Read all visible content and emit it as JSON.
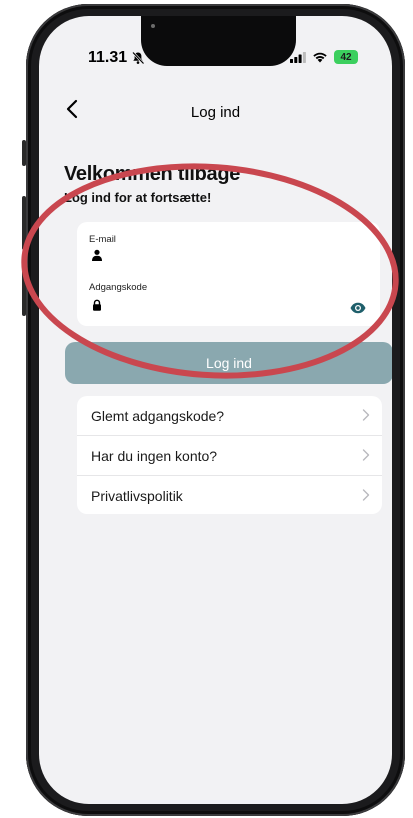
{
  "status_bar": {
    "time": "11.31",
    "battery": "42"
  },
  "nav": {
    "title": "Log ind"
  },
  "header": {
    "welcome": "Velkommen tilbage",
    "subtitle": "Log ind for at fortsætte!"
  },
  "form": {
    "email_label": "E-mail",
    "password_label": "Adgangskode"
  },
  "login_button": {
    "label": "Log ind"
  },
  "links": [
    {
      "label": "Glemt adgangskode?"
    },
    {
      "label": "Har du ingen konto?"
    },
    {
      "label": "Privatlivspolitik"
    }
  ],
  "icons": {
    "back": "chevron-left-icon",
    "mute": "bell-slash-icon",
    "signal": "signal-icon",
    "wifi": "wifi-icon",
    "user": "person-icon",
    "lock": "lock-icon",
    "eye": "eye-icon",
    "chevron": "chevron-right-icon"
  },
  "colors": {
    "login_button": "#8aa8af",
    "eye_icon": "#1f5f6b",
    "annotation": "#c9474f",
    "screen_background": "#f2f2f4"
  }
}
